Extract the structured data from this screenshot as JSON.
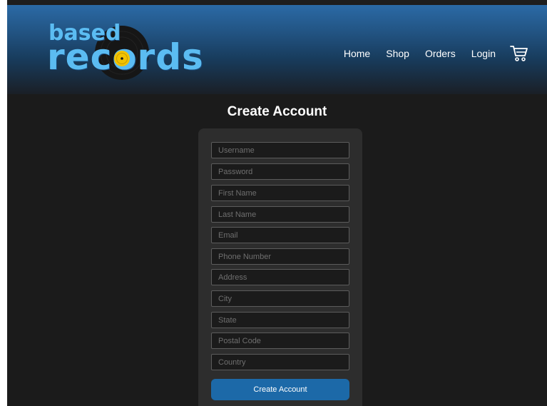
{
  "brand": {
    "logo_top": "based",
    "logo_bottom": "records",
    "colors": {
      "logo_text": "#5bbcf2",
      "vinyl": "#1a1a1a",
      "vinyl_label": "#f2c200"
    }
  },
  "nav": {
    "items": [
      {
        "label": "Home"
      },
      {
        "label": "Shop"
      },
      {
        "label": "Orders"
      },
      {
        "label": "Login"
      }
    ],
    "cart_icon": "cart-icon"
  },
  "page": {
    "title": "Create Account"
  },
  "form": {
    "fields": [
      {
        "placeholder": "Username",
        "value": ""
      },
      {
        "placeholder": "Password",
        "value": ""
      },
      {
        "placeholder": "First Name",
        "value": ""
      },
      {
        "placeholder": "Last Name",
        "value": ""
      },
      {
        "placeholder": "Email",
        "value": ""
      },
      {
        "placeholder": "Phone Number",
        "value": ""
      },
      {
        "placeholder": "Address",
        "value": ""
      },
      {
        "placeholder": "City",
        "value": ""
      },
      {
        "placeholder": "State",
        "value": ""
      },
      {
        "placeholder": "Postal Code",
        "value": ""
      },
      {
        "placeholder": "Country",
        "value": ""
      }
    ],
    "submit_label": "Create Account",
    "colors": {
      "submit": "#1c69a8",
      "card": "#2d2d2d"
    }
  }
}
